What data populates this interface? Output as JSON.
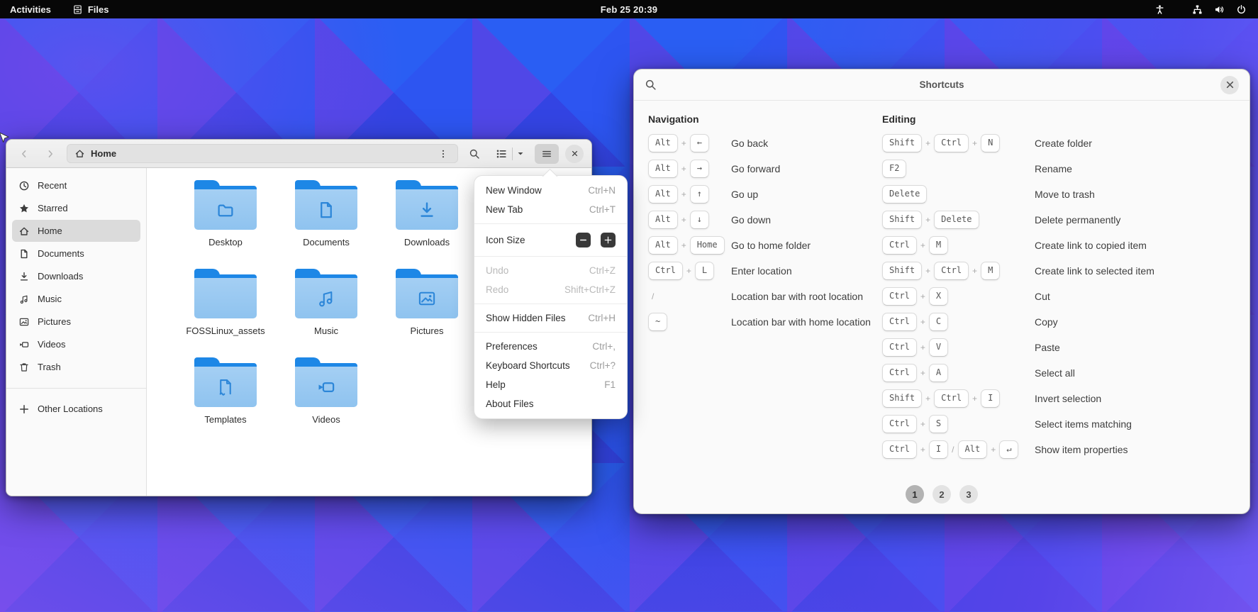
{
  "topbar": {
    "activities_label": "Activities",
    "app_name": "Files",
    "clock": "Feb 25 20:39",
    "status_icons": [
      "accessibility-icon",
      "network-icon",
      "volume-icon",
      "power-icon"
    ]
  },
  "files_window": {
    "pathbar_location": "Home",
    "header_icons": [
      "chevron-left-icon",
      "chevron-right-icon",
      "home-icon",
      "kebab-icon",
      "search-icon",
      "list-view-icon",
      "chevron-down-icon",
      "hamburger-icon",
      "close-icon"
    ],
    "sidebar": {
      "items": [
        {
          "label": "Recent",
          "icon": "clock-icon",
          "selected": false
        },
        {
          "label": "Starred",
          "icon": "star-icon",
          "selected": false
        },
        {
          "label": "Home",
          "icon": "home-icon",
          "selected": true
        },
        {
          "label": "Documents",
          "icon": "document-icon",
          "selected": false
        },
        {
          "label": "Downloads",
          "icon": "download-icon",
          "selected": false
        },
        {
          "label": "Music",
          "icon": "music-icon",
          "selected": false
        },
        {
          "label": "Pictures",
          "icon": "image-icon",
          "selected": false
        },
        {
          "label": "Videos",
          "icon": "video-icon",
          "selected": false
        },
        {
          "label": "Trash",
          "icon": "trash-icon",
          "selected": false
        }
      ],
      "other_locations": "Other Locations",
      "other_locations_icon": "plus-icon"
    },
    "folders": [
      {
        "name": "Desktop",
        "emblem": "emblem-folder"
      },
      {
        "name": "Documents",
        "emblem": "emblem-document"
      },
      {
        "name": "Downloads",
        "emblem": "emblem-download"
      },
      {
        "name": "FOSSLinux_assets",
        "emblem": null
      },
      {
        "name": "Music",
        "emblem": "emblem-music"
      },
      {
        "name": "Pictures",
        "emblem": "emblem-image"
      },
      {
        "name": "Templates",
        "emblem": "emblem-template"
      },
      {
        "name": "Videos",
        "emblem": "emblem-video"
      }
    ],
    "menu": {
      "items": [
        {
          "type": "item",
          "label": "New Window",
          "shortcut": "Ctrl+N"
        },
        {
          "type": "item",
          "label": "New Tab",
          "shortcut": "Ctrl+T"
        },
        {
          "type": "separator"
        },
        {
          "type": "icon-size",
          "label": "Icon Size",
          "minus_icon": "minus-icon",
          "plus_icon": "plus-icon"
        },
        {
          "type": "separator"
        },
        {
          "type": "item",
          "label": "Undo",
          "shortcut": "Ctrl+Z",
          "disabled": true
        },
        {
          "type": "item",
          "label": "Redo",
          "shortcut": "Shift+Ctrl+Z",
          "disabled": true
        },
        {
          "type": "separator"
        },
        {
          "type": "item",
          "label": "Show Hidden Files",
          "shortcut": "Ctrl+H"
        },
        {
          "type": "separator"
        },
        {
          "type": "item",
          "label": "Preferences",
          "shortcut": "Ctrl+,"
        },
        {
          "type": "item",
          "label": "Keyboard Shortcuts",
          "shortcut": "Ctrl+?"
        },
        {
          "type": "item",
          "label": "Help",
          "shortcut": "F1"
        },
        {
          "type": "item",
          "label": "About Files",
          "shortcut": ""
        }
      ]
    }
  },
  "shortcuts_window": {
    "title": "Shortcuts",
    "search_icon": "search-icon",
    "close_icon": "close-icon",
    "sections": [
      {
        "title": "Navigation",
        "rows": [
          {
            "keys": [
              "Alt",
              "+",
              "←"
            ],
            "label": "Go back"
          },
          {
            "keys": [
              "Alt",
              "+",
              "→"
            ],
            "label": "Go forward"
          },
          {
            "keys": [
              "Alt",
              "+",
              "↑"
            ],
            "label": "Go up"
          },
          {
            "keys": [
              "Alt",
              "+",
              "↓"
            ],
            "label": "Go down"
          },
          {
            "keys": [
              "Alt",
              "+",
              "Home"
            ],
            "label": "Go to home folder"
          },
          {
            "keys": [
              "Ctrl",
              "+",
              "L"
            ],
            "label": "Enter location"
          },
          {
            "keys": [
              "/"
            ],
            "label": "Location bar with root location"
          },
          {
            "keys": [
              "~"
            ],
            "label": "Location bar with home location"
          }
        ]
      },
      {
        "title": "Editing",
        "rows": [
          {
            "keys": [
              "Shift",
              "+",
              "Ctrl",
              "+",
              "N"
            ],
            "label": "Create folder"
          },
          {
            "keys": [
              "F2"
            ],
            "label": "Rename"
          },
          {
            "keys": [
              "Delete"
            ],
            "label": "Move to trash"
          },
          {
            "keys": [
              "Shift",
              "+",
              "Delete"
            ],
            "label": "Delete permanently"
          },
          {
            "keys": [
              "Ctrl",
              "+",
              "M"
            ],
            "label": "Create link to copied item"
          },
          {
            "keys": [
              "Shift",
              "+",
              "Ctrl",
              "+",
              "M"
            ],
            "label": "Create link to selected item"
          },
          {
            "keys": [
              "Ctrl",
              "+",
              "X"
            ],
            "label": "Cut"
          },
          {
            "keys": [
              "Ctrl",
              "+",
              "C"
            ],
            "label": "Copy"
          },
          {
            "keys": [
              "Ctrl",
              "+",
              "V"
            ],
            "label": "Paste"
          },
          {
            "keys": [
              "Ctrl",
              "+",
              "A"
            ],
            "label": "Select all"
          },
          {
            "keys": [
              "Shift",
              "+",
              "Ctrl",
              "+",
              "I"
            ],
            "label": "Invert selection"
          },
          {
            "keys": [
              "Ctrl",
              "+",
              "S"
            ],
            "label": "Select items matching"
          },
          {
            "keys": [
              "Ctrl",
              "+",
              "I",
              "/",
              "Alt",
              "+",
              "↵"
            ],
            "label": "Show item properties"
          }
        ]
      }
    ],
    "pages": [
      "1",
      "2",
      "3"
    ],
    "active_page": "1"
  },
  "colors": {
    "folder_body": "#99c9f3",
    "folder_tab": "#1d87e6",
    "emblem_blue": "#2c86d8",
    "sidebar_selection": "#dbdbdb",
    "topbar_bg": "#070707"
  }
}
